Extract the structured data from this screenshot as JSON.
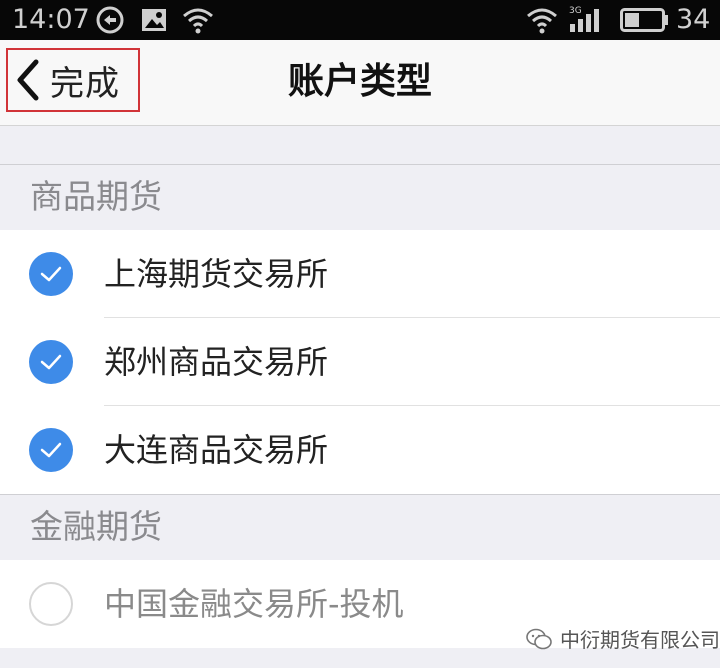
{
  "status_bar": {
    "time": "14:07",
    "network_label": "3G",
    "battery_level": "34"
  },
  "nav": {
    "back_label": "完成",
    "title": "账户类型"
  },
  "sections": [
    {
      "header": "商品期货",
      "items": [
        {
          "label": "上海期货交易所",
          "checked": true
        },
        {
          "label": "郑州商品交易所",
          "checked": true
        },
        {
          "label": "大连商品交易所",
          "checked": true
        }
      ]
    },
    {
      "header": "金融期货",
      "items": [
        {
          "label": "中国金融交易所-投机",
          "checked": false
        }
      ]
    }
  ],
  "watermark": "中衍期货有限公司",
  "colors": {
    "accent": "#3e8be8",
    "highlight_box": "#d13438"
  }
}
